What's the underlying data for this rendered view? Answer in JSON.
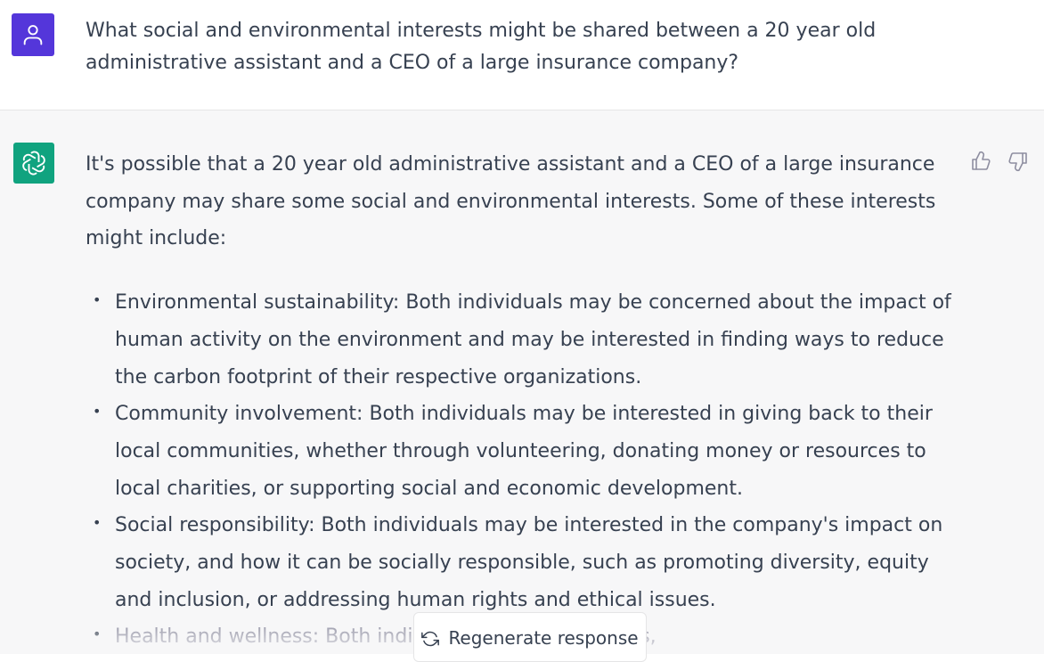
{
  "colors": {
    "user_avatar": "#5436DA",
    "assistant_avatar": "#10A37F"
  },
  "user_message": {
    "avatar_icon": "person-icon",
    "text": "What social and environmental interests might be shared between a 20 year old administrative assistant and a CEO of a large insurance company?"
  },
  "assistant_message": {
    "avatar_icon": "openai-logo-icon",
    "intro": "It's possible that a 20 year old administrative assistant and a CEO of a large insurance company may share some social and environmental interests. Some of these interests might include:",
    "items": [
      "Environmental sustainability: Both individuals may be concerned about the impact of human activity on the environment and may be interested in finding ways to reduce the carbon footprint of their respective organizations.",
      "Community involvement: Both individuals may be interested in giving back to their local communities, whether through volunteering, donating money or resources to local charities, or supporting social and economic development.",
      "Social responsibility: Both individuals may be interested in the company's impact on society, and how it can be socially responsible, such as promoting diversity, equity and inclusion, or addressing human rights and ethical issues.",
      "Health and wellness: Both indivi n health and wellness,"
    ],
    "feedback": {
      "thumbs_up_icon": "thumbs-up-icon",
      "thumbs_down_icon": "thumbs-down-icon"
    }
  },
  "regenerate": {
    "icon": "refresh-icon",
    "label": "Regenerate response"
  }
}
